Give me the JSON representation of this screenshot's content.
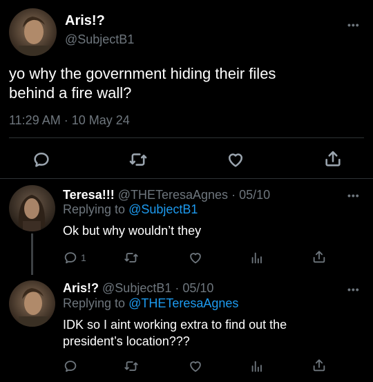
{
  "main_tweet": {
    "display_name": "Aris!?",
    "handle": "@SubjectB1",
    "text_line1": "yo why the government hiding their files",
    "text_line2": "behind a fire wall?",
    "time": "11:29 AM",
    "sep": "·",
    "date": "10 May 24"
  },
  "replies": [
    {
      "display_name": "Teresa!!!",
      "handle": "@THETeresaAgnes",
      "date": "· 05/10",
      "replying_prefix": "Replying to",
      "replying_to": "@SubjectB1",
      "text": "Ok but why wouldn’t they",
      "reply_count": "1"
    },
    {
      "display_name": "Aris!?",
      "handle": "@SubjectB1",
      "date": "· 05/10",
      "replying_prefix": "Replying to",
      "replying_to": "@THETeresaAgnes",
      "text_line1": "IDK so I aint working extra to find out the",
      "text_line2": "president’s location???"
    }
  ],
  "more_label": "•••",
  "colors": {
    "background": "#000000",
    "muted": "#6e767d",
    "link": "#1d9bf0",
    "divider": "#2f3336"
  }
}
